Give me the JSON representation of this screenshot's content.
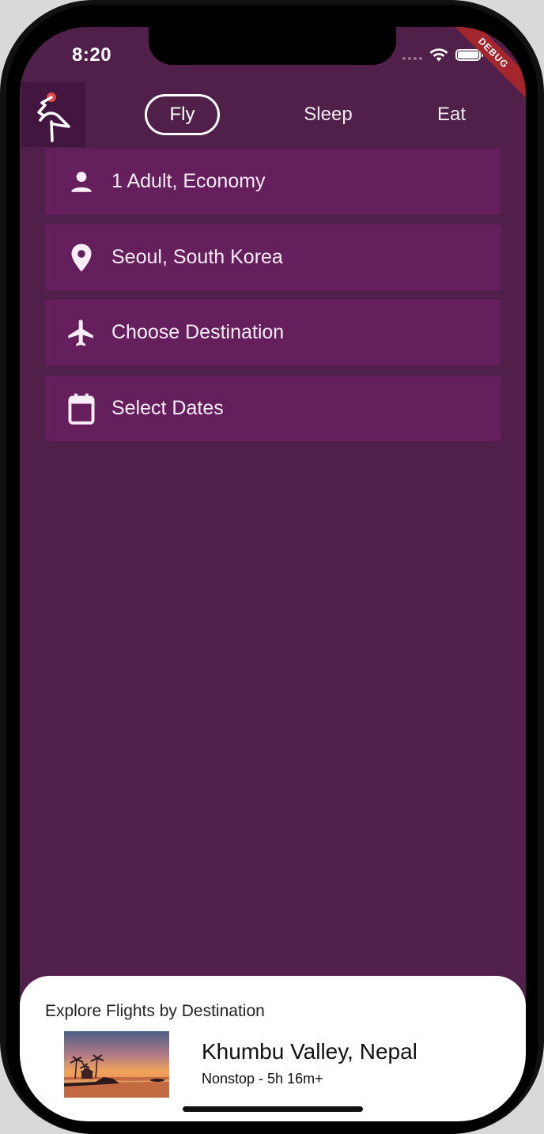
{
  "status_bar": {
    "time": "8:20",
    "debug_label": "DEBUG"
  },
  "top_tabs": [
    {
      "label": "Fly",
      "active": true
    },
    {
      "label": "Sleep",
      "active": false
    },
    {
      "label": "Eat",
      "active": false
    }
  ],
  "form": {
    "travelers": "1 Adult, Economy",
    "origin": "Seoul, South Korea",
    "destination": "Choose Destination",
    "dates": "Select Dates"
  },
  "explore": {
    "title": "Explore Flights by Destination",
    "items": [
      {
        "name": "Khumbu Valley, Nepal",
        "subtitle": "Nonstop - 5h 16m+"
      }
    ]
  },
  "colors": {
    "background": "#50204b",
    "field": "#651f5d",
    "logo_box": "#43163f",
    "debug_banner": "#a3262c"
  }
}
